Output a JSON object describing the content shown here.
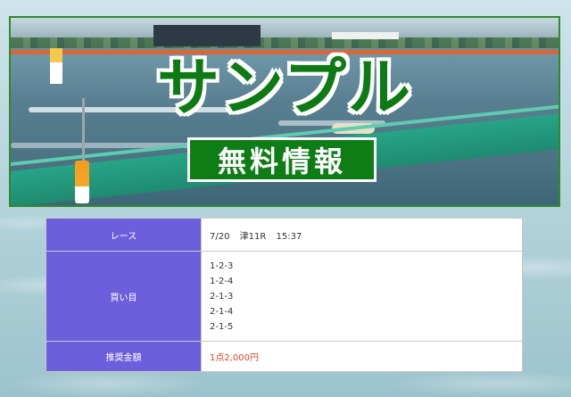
{
  "banner": {
    "title": "サンプル",
    "subtitle": "無料情報"
  },
  "table": {
    "race": {
      "label": "レース",
      "date": "7/20",
      "venue_race": "津11R",
      "time": "15:37"
    },
    "bets": {
      "label": "買い目",
      "items": [
        "1-2-3",
        "1-2-4",
        "2-1-3",
        "2-1-4",
        "2-1-5"
      ]
    },
    "price": {
      "label": "推奨金額",
      "value": "1点2,000円",
      "color": "#e0462b"
    }
  },
  "colors": {
    "header_cell": "#6d5fdc",
    "banner_green": "#0f7d16",
    "banner_border": "#2f8a2f"
  }
}
